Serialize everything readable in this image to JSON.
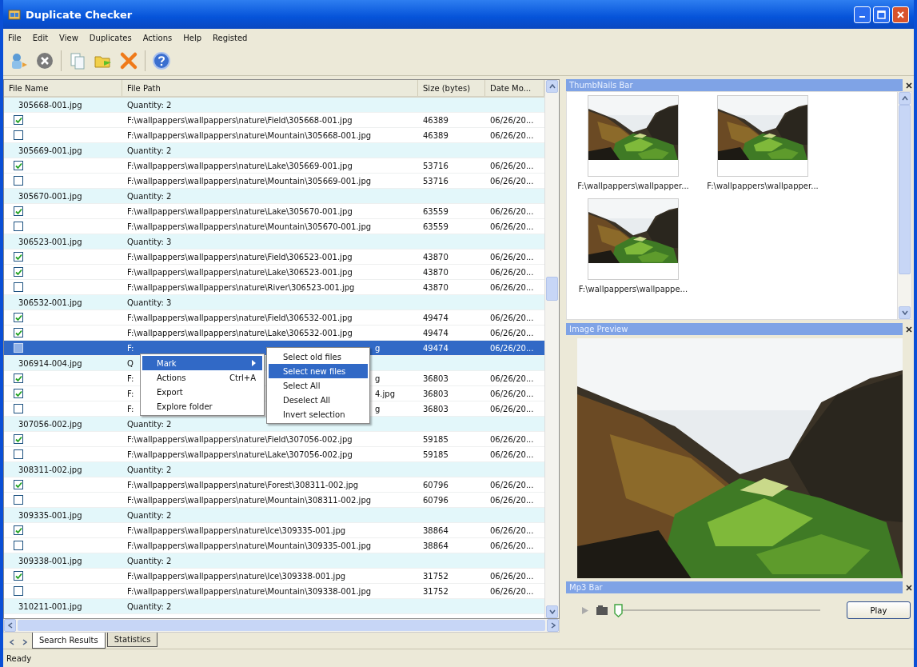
{
  "window": {
    "title": "Duplicate Checker"
  },
  "menu": [
    "File",
    "Edit",
    "View",
    "Duplicates",
    "Actions",
    "Help",
    "Registed"
  ],
  "table": {
    "columns": [
      "File Name",
      "File Path",
      "Size (bytes)",
      "Date Mo..."
    ],
    "rows": [
      {
        "kind": "group",
        "name": "305668-001.jpg",
        "path": "Quantity: 2",
        "selected": false
      },
      {
        "kind": "file",
        "checked": true,
        "selected": false,
        "path": "F:\\wallpappers\\wallpappers\\nature\\Field\\305668-001.jpg",
        "size": "46389",
        "date": "06/26/20..."
      },
      {
        "kind": "file",
        "checked": false,
        "selected": false,
        "path": "F:\\wallpappers\\wallpappers\\nature\\Mountain\\305668-001.jpg",
        "size": "46389",
        "date": "06/26/20..."
      },
      {
        "kind": "group",
        "name": "305669-001.jpg",
        "path": "Quantity: 2",
        "selected": false
      },
      {
        "kind": "file",
        "checked": true,
        "selected": false,
        "path": "F:\\wallpappers\\wallpappers\\nature\\Lake\\305669-001.jpg",
        "size": "53716",
        "date": "06/26/20..."
      },
      {
        "kind": "file",
        "checked": false,
        "selected": false,
        "path": "F:\\wallpappers\\wallpappers\\nature\\Mountain\\305669-001.jpg",
        "size": "53716",
        "date": "06/26/20..."
      },
      {
        "kind": "group",
        "name": "305670-001.jpg",
        "path": "Quantity: 2",
        "selected": false
      },
      {
        "kind": "file",
        "checked": true,
        "selected": false,
        "path": "F:\\wallpappers\\wallpappers\\nature\\Lake\\305670-001.jpg",
        "size": "63559",
        "date": "06/26/20..."
      },
      {
        "kind": "file",
        "checked": false,
        "selected": false,
        "path": "F:\\wallpappers\\wallpappers\\nature\\Mountain\\305670-001.jpg",
        "size": "63559",
        "date": "06/26/20..."
      },
      {
        "kind": "group",
        "name": "306523-001.jpg",
        "path": "Quantity: 3",
        "selected": false
      },
      {
        "kind": "file",
        "checked": true,
        "selected": false,
        "path": "F:\\wallpappers\\wallpappers\\nature\\Field\\306523-001.jpg",
        "size": "43870",
        "date": "06/26/20..."
      },
      {
        "kind": "file",
        "checked": true,
        "selected": false,
        "path": "F:\\wallpappers\\wallpappers\\nature\\Lake\\306523-001.jpg",
        "size": "43870",
        "date": "06/26/20..."
      },
      {
        "kind": "file",
        "checked": false,
        "selected": false,
        "path": "F:\\wallpappers\\wallpappers\\nature\\River\\306523-001.jpg",
        "size": "43870",
        "date": "06/26/20..."
      },
      {
        "kind": "group",
        "name": "306532-001.jpg",
        "path": "Quantity: 3",
        "selected": false
      },
      {
        "kind": "file",
        "checked": true,
        "selected": false,
        "path": "F:\\wallpappers\\wallpappers\\nature\\Field\\306532-001.jpg",
        "size": "49474",
        "date": "06/26/20..."
      },
      {
        "kind": "file",
        "checked": true,
        "selected": false,
        "path": "F:\\wallpappers\\wallpappers\\nature\\Lake\\306532-001.jpg",
        "size": "49474",
        "date": "06/26/20..."
      },
      {
        "kind": "file",
        "checked": false,
        "selected": true,
        "path": "F:",
        "path_tail": "g",
        "size": "49474",
        "date": "06/26/20..."
      },
      {
        "kind": "group",
        "name": "306914-004.jpg",
        "path": "Q",
        "selected": false
      },
      {
        "kind": "file",
        "checked": true,
        "selected": false,
        "path": "F:",
        "path_tail": "g",
        "size": "36803",
        "date": "06/26/20..."
      },
      {
        "kind": "file",
        "checked": true,
        "selected": false,
        "path": "F:",
        "path_tail": "4.jpg",
        "size": "36803",
        "date": "06/26/20..."
      },
      {
        "kind": "file",
        "checked": false,
        "selected": false,
        "path": "F:",
        "path_tail": "g",
        "size": "36803",
        "date": "06/26/20..."
      },
      {
        "kind": "group",
        "name": "307056-002.jpg",
        "path": "Quantity: 2",
        "selected": false
      },
      {
        "kind": "file",
        "checked": true,
        "selected": false,
        "path": "F:\\wallpappers\\wallpappers\\nature\\Field\\307056-002.jpg",
        "size": "59185",
        "date": "06/26/20..."
      },
      {
        "kind": "file",
        "checked": false,
        "selected": false,
        "path": "F:\\wallpappers\\wallpappers\\nature\\Lake\\307056-002.jpg",
        "size": "59185",
        "date": "06/26/20..."
      },
      {
        "kind": "group",
        "name": "308311-002.jpg",
        "path": "Quantity: 2",
        "selected": false
      },
      {
        "kind": "file",
        "checked": true,
        "selected": false,
        "path": "F:\\wallpappers\\wallpappers\\nature\\Forest\\308311-002.jpg",
        "size": "60796",
        "date": "06/26/20..."
      },
      {
        "kind": "file",
        "checked": false,
        "selected": false,
        "path": "F:\\wallpappers\\wallpappers\\nature\\Mountain\\308311-002.jpg",
        "size": "60796",
        "date": "06/26/20..."
      },
      {
        "kind": "group",
        "name": "309335-001.jpg",
        "path": "Quantity: 2",
        "selected": false
      },
      {
        "kind": "file",
        "checked": true,
        "selected": false,
        "path": "F:\\wallpappers\\wallpappers\\nature\\Ice\\309335-001.jpg",
        "size": "38864",
        "date": "06/26/20..."
      },
      {
        "kind": "file",
        "checked": false,
        "selected": false,
        "path": "F:\\wallpappers\\wallpappers\\nature\\Mountain\\309335-001.jpg",
        "size": "38864",
        "date": "06/26/20..."
      },
      {
        "kind": "group",
        "name": "309338-001.jpg",
        "path": "Quantity: 2",
        "selected": false
      },
      {
        "kind": "file",
        "checked": true,
        "selected": false,
        "path": "F:\\wallpappers\\wallpappers\\nature\\Ice\\309338-001.jpg",
        "size": "31752",
        "date": "06/26/20..."
      },
      {
        "kind": "file",
        "checked": false,
        "selected": false,
        "path": "F:\\wallpappers\\wallpappers\\nature\\Mountain\\309338-001.jpg",
        "size": "31752",
        "date": "06/26/20..."
      },
      {
        "kind": "group",
        "name": "310211-001.jpg",
        "path": "Quantity: 2",
        "selected": false
      }
    ]
  },
  "context_menu": {
    "items": [
      {
        "label": "Mark",
        "has_submenu": true,
        "selected": true
      },
      {
        "label": "Actions",
        "shortcut": "Ctrl+A",
        "has_submenu": false,
        "selected": false
      },
      {
        "label": "Export",
        "has_submenu": false,
        "selected": false
      },
      {
        "label": "Explore folder",
        "has_submenu": false,
        "selected": false
      }
    ],
    "submenu": [
      {
        "label": "Select old files",
        "selected": false
      },
      {
        "label": "Select new files",
        "selected": true
      },
      {
        "label": "Select All",
        "selected": false
      },
      {
        "label": "Deselect All",
        "selected": false
      },
      {
        "label": "Invert selection",
        "selected": false
      }
    ]
  },
  "tabs": [
    {
      "label": "Search Results",
      "selected": true
    },
    {
      "label": "Statistics",
      "selected": false
    }
  ],
  "thumbnails_bar": {
    "title": "ThumbNails Bar",
    "items": [
      {
        "caption": "F:\\wallpappers\\wallpapper..."
      },
      {
        "caption": "F:\\wallpappers\\wallpapper..."
      },
      {
        "caption": "F:\\wallpappers\\wallpappe..."
      }
    ]
  },
  "image_preview": {
    "title": "Image Preview"
  },
  "mp3_bar": {
    "title": "Mp3 Bar",
    "level": 0,
    "button": "Play"
  },
  "status_bar": {
    "text": "Ready"
  }
}
